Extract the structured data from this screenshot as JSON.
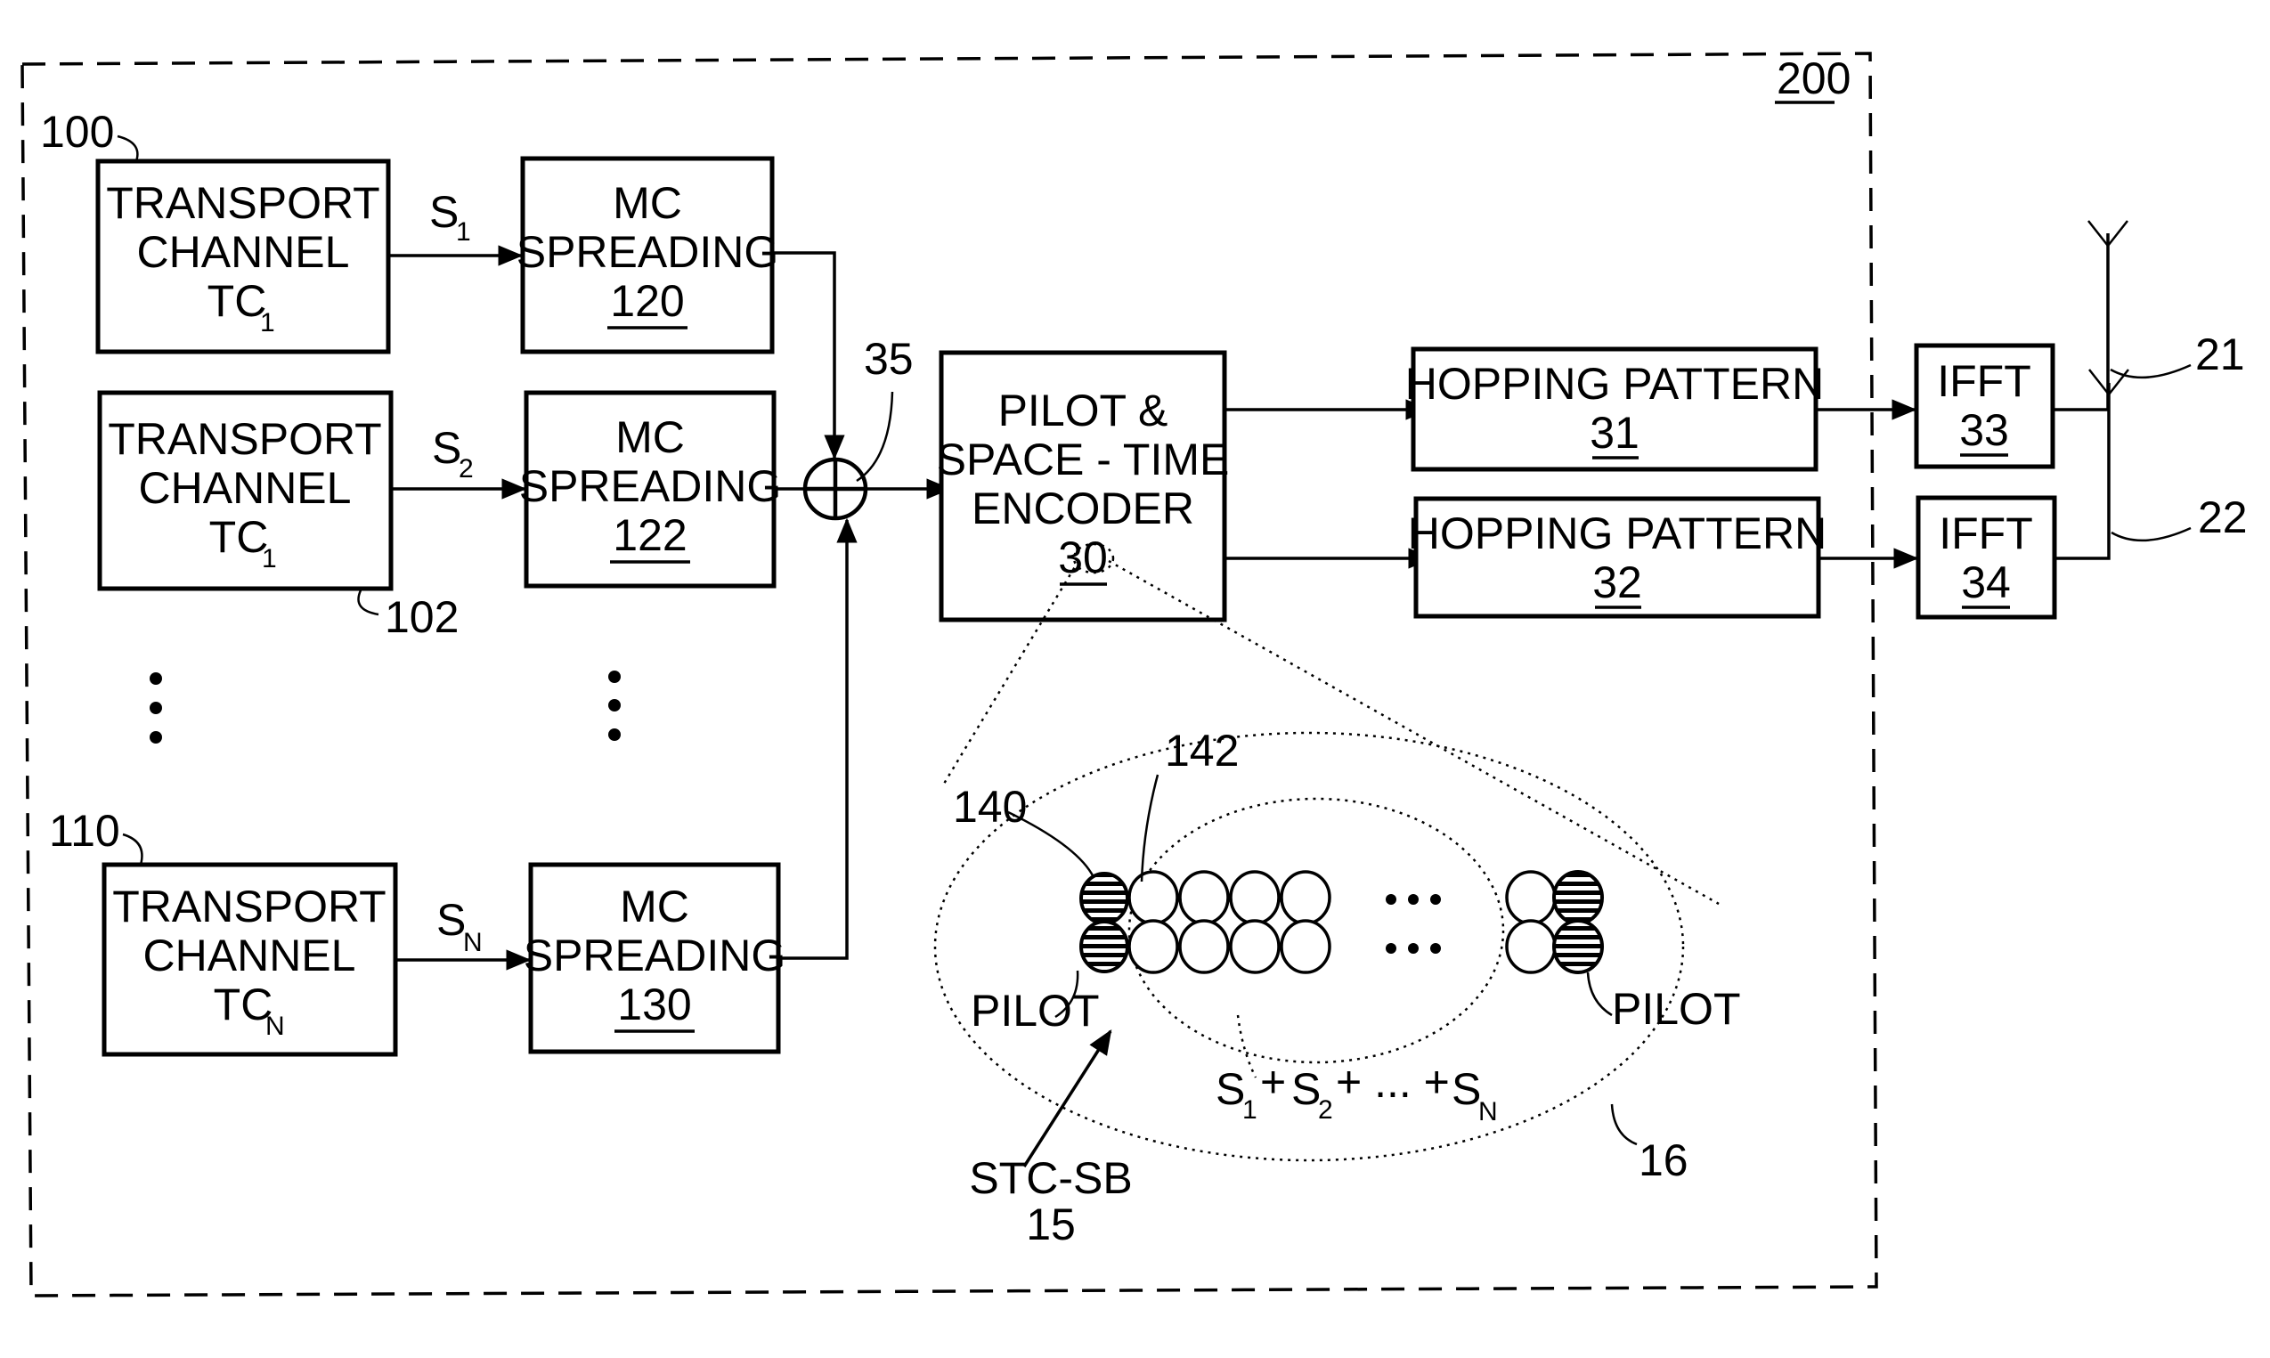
{
  "figure": {
    "frame_ref": "200",
    "transport_channels": [
      {
        "line1": "TRANSPORT",
        "line2": "CHANNEL",
        "line3": "TC",
        "sub": "1",
        "ref": "100"
      },
      {
        "line1": "TRANSPORT",
        "line2": "CHANNEL",
        "line3": "TC",
        "sub": "1",
        "ref": "102"
      },
      {
        "line1": "TRANSPORT",
        "line2": "CHANNEL",
        "line3": "TC",
        "sub": "N",
        "ref": "110"
      }
    ],
    "signals": [
      {
        "name": "S",
        "sub": "1"
      },
      {
        "name": "S",
        "sub": "2"
      },
      {
        "name": "S",
        "sub": "N"
      }
    ],
    "spreaders": [
      {
        "line1": "MC",
        "line2": "SPREADING",
        "ref": "120"
      },
      {
        "line1": "MC",
        "line2": "SPREADING",
        "ref": "122"
      },
      {
        "line1": "MC",
        "line2": "SPREADING",
        "ref": "130"
      }
    ],
    "summer_ref": "35",
    "encoder": {
      "line1": "PILOT &",
      "line2": "SPACE - TIME",
      "line3": "ENCODER",
      "ref": "30"
    },
    "hopping": [
      {
        "label": "HOPPING PATTERN",
        "ref": "31"
      },
      {
        "label": "HOPPING PATTERN",
        "ref": "32"
      }
    ],
    "ifft": [
      {
        "label": "IFFT",
        "ref": "33"
      },
      {
        "label": "IFFT",
        "ref": "34"
      }
    ],
    "antennas": [
      {
        "ref": "21"
      },
      {
        "ref": "22"
      }
    ],
    "detail": {
      "pilot_ref": "140",
      "data_ref": "142",
      "pilot_left_label": "PILOT",
      "pilot_right_label": "PILOT",
      "ellipsis": "• • •",
      "sum_label": {
        "s1": "S",
        "s1_sub": "1",
        "plus1": "+",
        "s2": "S",
        "s2_sub": "2",
        "mid": "+ ... +",
        "sn": "S",
        "sn_sub": "N"
      },
      "block_label": "STC-SB",
      "block_ref": "15",
      "outer_ref": "16"
    }
  }
}
